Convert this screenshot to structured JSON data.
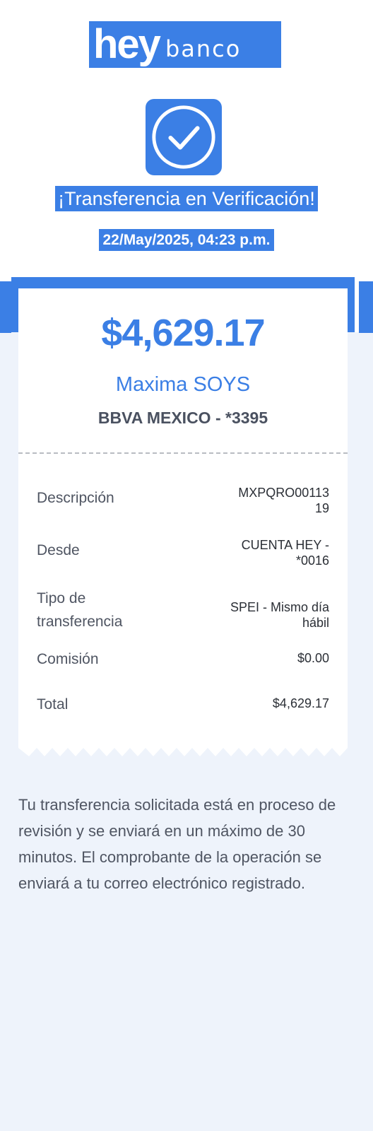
{
  "brand": {
    "logo_word": "hey",
    "logo_suffix": "banco",
    "accent": "#3b7fe5"
  },
  "status": {
    "icon": "check-circle-icon",
    "title": "¡Transferencia en Verificación!",
    "datetime": "22/May/2025, 04:23 p.m."
  },
  "receipt": {
    "amount": "$4,629.17",
    "recipient": "Maxima SOYS",
    "bank": "BBVA MEXICO - *3395",
    "rows": [
      {
        "label": "Descripción",
        "value": "MXPQRO00113 19"
      },
      {
        "label": "Desde",
        "value": "CUENTA HEY - *0016"
      },
      {
        "label": "Tipo de transferencia",
        "value": "SPEI - Mismo día hábil"
      },
      {
        "label": "Comisión",
        "value": "$0.00"
      },
      {
        "label": "Total",
        "value": "$4,629.17"
      }
    ]
  },
  "info_text": "Tu transferencia solicitada está en proceso de revisión y se enviará en un máximo de 30 minutos. El comprobante de la operación se enviará a tu correo electrónico registrado."
}
